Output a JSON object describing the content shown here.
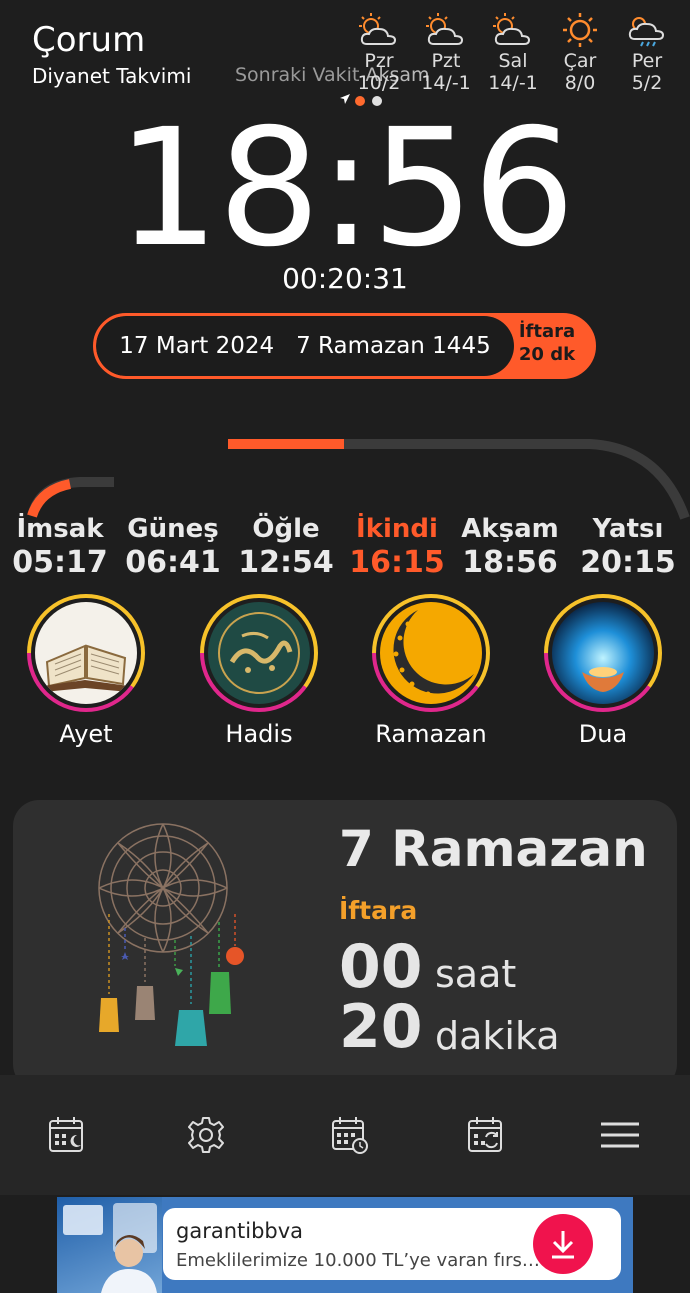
{
  "header": {
    "city": "Çorum",
    "source": "Diyanet Takvimi",
    "next_prefix": "Sonraki Vakit",
    "next_name": "Akşam"
  },
  "weather": [
    {
      "day": "Pzr",
      "temps": "10/2",
      "icon": "partly-cloudy-icon"
    },
    {
      "day": "Pzt",
      "temps": "14/-1",
      "icon": "partly-cloudy-icon"
    },
    {
      "day": "Sal",
      "temps": "14/-1",
      "icon": "partly-cloudy-icon"
    },
    {
      "day": "Çar",
      "temps": "8/0",
      "icon": "sunny-icon"
    },
    {
      "day": "Per",
      "temps": "5/2",
      "icon": "rain-icon"
    }
  ],
  "clock": {
    "time": "18:56",
    "countdown": "00:20:31"
  },
  "datebar": {
    "gregorian": "17 Mart 2024",
    "hijri": "7 Ramazan 1445",
    "iftar_label": "İftara",
    "iftar_remaining": "20 dk"
  },
  "prayers": [
    {
      "name": "İmsak",
      "time": "05:17",
      "active": false
    },
    {
      "name": "Güneş",
      "time": "06:41",
      "active": false
    },
    {
      "name": "Öğle",
      "time": "12:54",
      "active": false
    },
    {
      "name": "İkindi",
      "time": "16:15",
      "active": true
    },
    {
      "name": "Akşam",
      "time": "18:56",
      "active": false
    },
    {
      "name": "Yatsı",
      "time": "20:15",
      "active": false
    }
  ],
  "shortcuts": [
    {
      "label": "Ayet",
      "icon": "quran-icon"
    },
    {
      "label": "Hadis",
      "icon": "calligraphy-icon"
    },
    {
      "label": "Ramazan",
      "icon": "crescent-icon"
    },
    {
      "label": "Dua",
      "icon": "praying-hands-icon"
    }
  ],
  "ramadan_card": {
    "title": "7 Ramazan",
    "label": "İftara",
    "hours": "00",
    "hours_unit": "saat",
    "minutes": "20",
    "minutes_unit": "dakika"
  },
  "toolbar": {
    "items": [
      "calendar-moon-icon",
      "settings-gear-icon",
      "calendar-clock-icon",
      "calendar-sync-icon",
      "menu-icon"
    ]
  },
  "ad": {
    "brand": "garantibbva",
    "text": "Emeklilerimize 10.000 TL’ye varan fırs…"
  },
  "colors": {
    "accent": "#ff5a2a",
    "iftar_orange": "#f4a02a",
    "background": "#1e1e1e",
    "ring_yellow": "#f7c22a",
    "ring_pink": "#e0278c"
  }
}
